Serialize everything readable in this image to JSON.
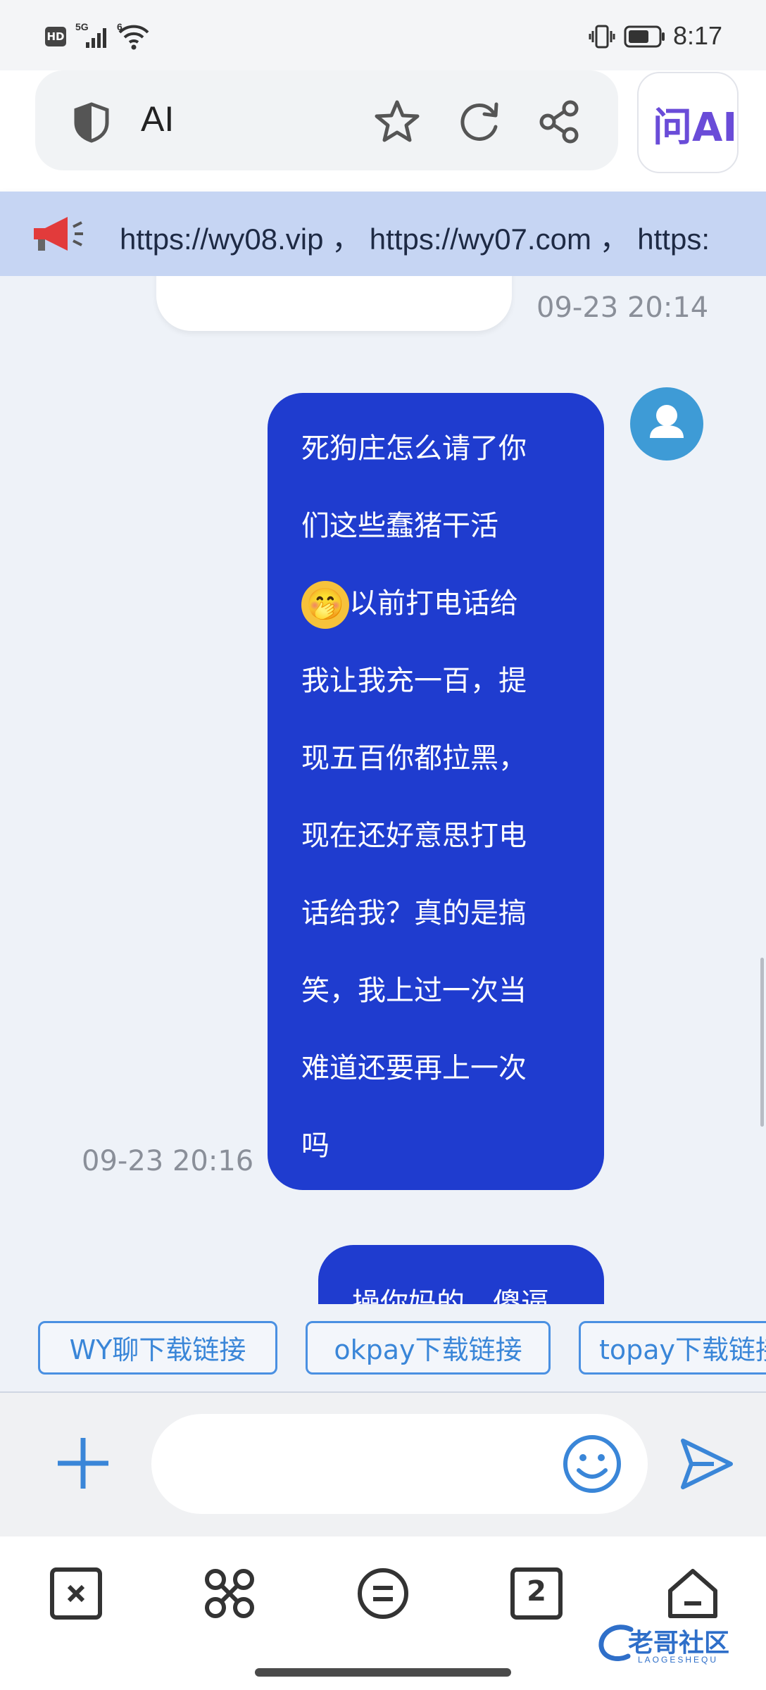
{
  "status_bar": {
    "network_badge": "HD",
    "signal_label": "5G",
    "wifi_label": "6",
    "time": "8:17"
  },
  "browser": {
    "address_text": "AI",
    "ai_button_label": "问AI",
    "icons": [
      "shield-icon",
      "star-icon",
      "refresh-icon",
      "share-icon"
    ]
  },
  "notice": {
    "text": "https://wy08.vip ， https://wy07.com ， https:"
  },
  "messages": [
    {
      "timestamp": "09-23 20:14"
    },
    {
      "timestamp": "09-23 20:16",
      "lines": [
        "死狗庄怎么请了你",
        "们这些蠢猪干活",
        "以前打电话给",
        "我让我充一百，提",
        "现五百你都拉黑，",
        "现在还好意思打电",
        "话给我？真的是搞",
        "笑，我上过一次当",
        "难道还要再上一次",
        "吗"
      ],
      "emoji": "🤭"
    },
    {
      "partial_text": "操你妈的，傻逼"
    }
  ],
  "quick_links": [
    "WY聊下载链接",
    "okpay下载链接",
    "topay下载链接"
  ],
  "input": {
    "placeholder": ""
  },
  "bottom_nav": {
    "tabs_count": "2"
  },
  "watermark": {
    "text": "老哥社区",
    "subtext": "LAOGESHEQU"
  },
  "colors": {
    "user_bubble": "#1f3ccf",
    "notice_bg": "#c6d5f3",
    "accent": "#4a90e2",
    "avatar": "#3e9bd6"
  }
}
